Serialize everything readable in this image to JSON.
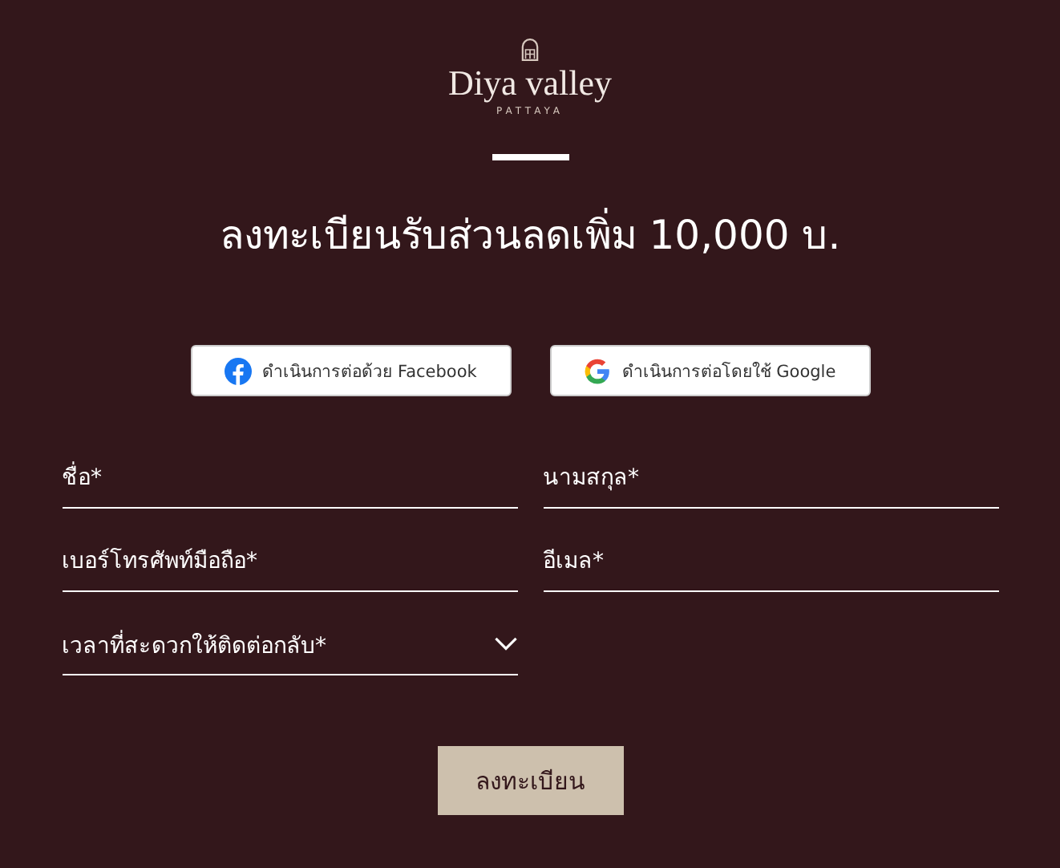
{
  "brand": {
    "name": "Diya valley",
    "location": "PATTAYA"
  },
  "heading": "ลงทะเบียนรับส่วนลดเพิ่ม 10,000 บ.",
  "social_buttons": [
    {
      "kind": "facebook",
      "label": "ดำเนินการต่อด้วย Facebook"
    },
    {
      "kind": "google",
      "label": "ดำเนินการต่อโดยใช้ Google"
    }
  ],
  "fields": [
    {
      "kind": "text",
      "placeholder": "ชื่อ*"
    },
    {
      "kind": "text",
      "placeholder": "นามสกุล*"
    },
    {
      "kind": "text",
      "placeholder": "เบอร์โทรศัพท์มือถือ*"
    },
    {
      "kind": "text",
      "placeholder": "อีเมล*"
    },
    {
      "kind": "select",
      "placeholder": "เวลาที่สะดวกให้ติดต่อกลับ*"
    }
  ],
  "submit_button": "ลงทะเบียน"
}
